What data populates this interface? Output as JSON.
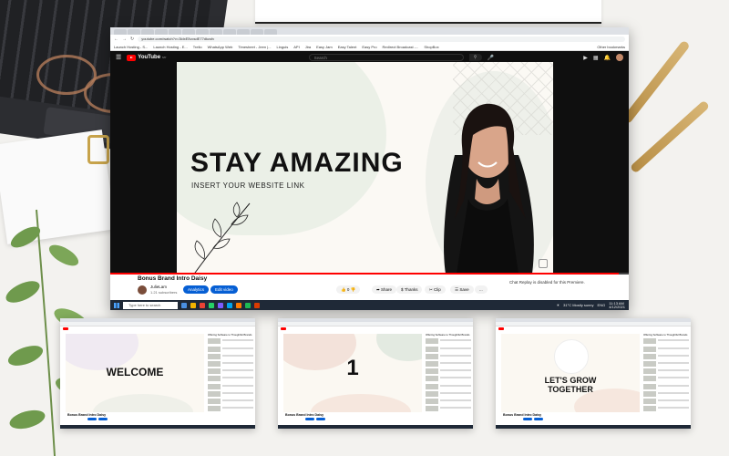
{
  "browser": {
    "url": "youtube.com/watch?v=3ldxE5vcsdE77dkcsfv",
    "bookmarks": [
      "Launch Hosting - S...",
      "Launch Hosting - E...",
      "Trello",
      "WhatsApp Web",
      "Timesheet - Jeen |...",
      "Linguis",
      "API",
      "Jira",
      "Easy Jam",
      "Easy Talent",
      "Easy Pro",
      "Redirect Broadcast -...",
      "ShopBox",
      "Other bookmarks"
    ]
  },
  "youtube": {
    "logo_text": "YouTube",
    "region": "MY",
    "search_placeholder": "Search"
  },
  "video": {
    "headline": "STAY AMAZING",
    "subheadline": "INSERT YOUR WEBSITE LINK",
    "progress_fraction": 0.98,
    "title": "Bonus Brand Intro Daisy",
    "channel_name": "JulieLam",
    "channel_subs": "1.21 subscribers",
    "analytics_label": "Analytics",
    "edit_label": "Edit video",
    "like_count": "0",
    "share_label": "Share",
    "thanks_label": "Thanks",
    "clip_label": "Clip",
    "save_label": "Save",
    "more_label": "...",
    "chat_note": "Chat Replay is disabled for this Premiere."
  },
  "taskbar": {
    "search_placeholder": "Type here to search",
    "weather": "31°C  Mostly sunny",
    "lang": "ENG",
    "time": "11:13 AM",
    "date": "4/12/2021"
  },
  "thumbnails": [
    {
      "text": "WELCOME",
      "title": "Bonus Brand Intro Daisy",
      "sidebar_header": "Offering Software to Thoughtful Brands"
    },
    {
      "text": "1",
      "title": "Bonus Brand Intro Daisy",
      "sidebar_header": "Offering Software to Thoughtful Brands"
    },
    {
      "text": "LET'S GROW TOGETHER",
      "title": "Bonus Brand Intro Daisy",
      "sidebar_header": "Offering Software to Thoughtful Brands"
    }
  ],
  "colors": {
    "youtube_red": "#ff0000",
    "action_blue": "#065fd4",
    "slide_background": "#fbf9f4"
  }
}
